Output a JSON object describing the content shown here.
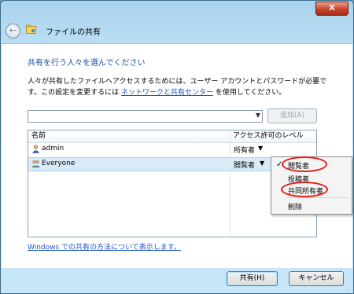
{
  "window": {
    "title": "ファイルの共有",
    "close_glyph": "X"
  },
  "heading": "共有を行う人々を選んでください",
  "description": {
    "text_before_link": "人々が共有したファイルへアクセスするためには、ユーザー アカウントとパスワードが必要です。この設定を変更するには ",
    "link": "ネットワークと共有センター",
    "text_after_link": " を使用してください。"
  },
  "name_combo": {
    "value": ""
  },
  "add_button": "追加(A)",
  "list": {
    "columns": [
      "名前",
      "アクセス許可のレベル"
    ],
    "rows": [
      {
        "name": "admin",
        "level": "所有者",
        "icon": "user-icon"
      },
      {
        "name": "Everyone",
        "level": "閲覧者",
        "icon": "group-icon"
      }
    ]
  },
  "menu": {
    "items": [
      "閲覧者",
      "投稿者",
      "共同所有者",
      "削除"
    ],
    "checked": "閲覧者"
  },
  "help_link": "Windows での共有の方法について表示します。",
  "buttons": {
    "share": "共有(H)",
    "cancel": "キャンセル"
  },
  "colors": {
    "heading": "#1b4ea1",
    "link": "#1f54c6",
    "highlight_oval": "#e3201b",
    "close": "#c4432c"
  }
}
